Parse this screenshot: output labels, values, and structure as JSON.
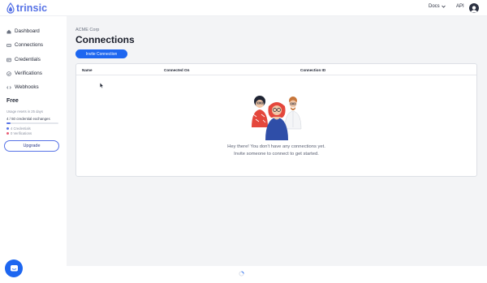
{
  "brand": {
    "name": "trinsic",
    "logo_icon": "drop-logo-icon",
    "color": "#5672e6"
  },
  "topbar": {
    "docs_label": "Docs",
    "api_label": "API",
    "avatar_icon": "user-avatar-icon"
  },
  "sidebar": {
    "items": [
      {
        "label": "Dashboard",
        "icon": "home-icon"
      },
      {
        "label": "Connections",
        "icon": "connections-icon"
      },
      {
        "label": "Credentials",
        "icon": "credentials-icon"
      },
      {
        "label": "Verifications",
        "icon": "verifications-icon"
      },
      {
        "label": "Webhooks",
        "icon": "webhooks-icon"
      }
    ],
    "plan": "Free",
    "usage_reset": "Usage resets in 25 days",
    "usage_count": "4 / 50 credential exchanges",
    "usage_fraction": 0.08,
    "legend": [
      {
        "label": "4 Credentials",
        "color": "#5672e6"
      },
      {
        "label": "0 Verifications",
        "color": "#e85d75"
      }
    ],
    "upgrade_label": "Upgrade"
  },
  "main": {
    "org_name": "ACME Corp",
    "title": "Connections",
    "invite_label": "Invite Connection",
    "table": {
      "columns": [
        "Name",
        "Connected On",
        "Connection ID"
      ]
    },
    "empty_line1": "Hey there! You don't have any connections yet.",
    "empty_line2": "Invite someone to connect to get started."
  },
  "accent_color": "#1d66f0"
}
